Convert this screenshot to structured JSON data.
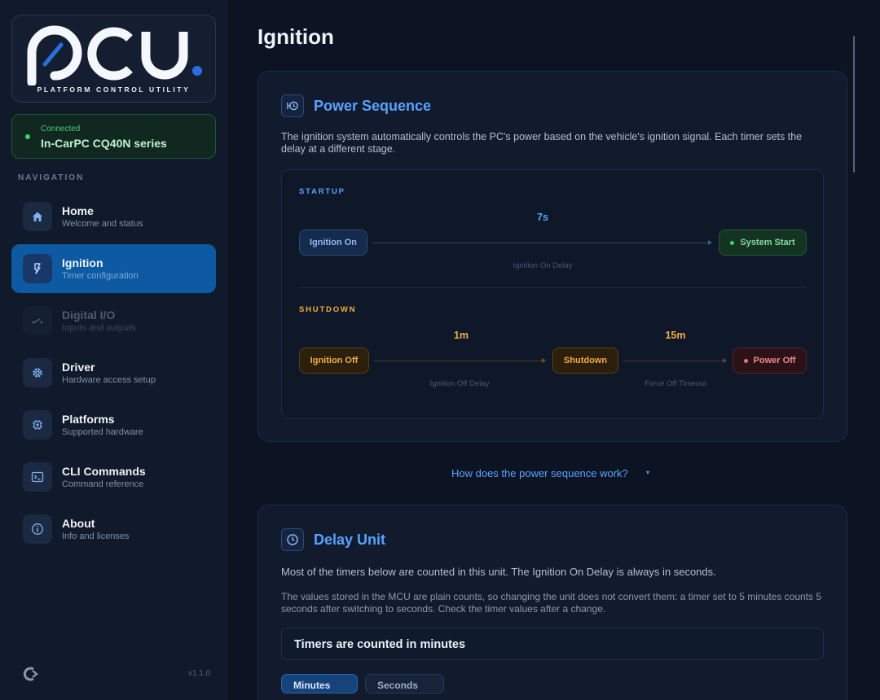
{
  "app": {
    "logo_text": "PCU",
    "logo_subtitle": "PLATFORM CONTROL UTILITY",
    "version": "v1.1.0"
  },
  "connection": {
    "status": "Connected",
    "device": "In-CarPC CQ40N series",
    "status_color": "#3bd273"
  },
  "navigation": {
    "title": "NAVIGATION",
    "items": [
      {
        "label": "Home",
        "sub": "Welcome and status",
        "icon": "home-icon"
      },
      {
        "label": "Ignition",
        "sub": "Timer configuration",
        "icon": "ignition-icon",
        "active": true
      },
      {
        "label": "Digital I/O",
        "sub": "Inputs and outputs",
        "icon": "switch-icon",
        "disabled": true
      },
      {
        "label": "Driver",
        "sub": "Hardware access setup",
        "icon": "gear-icon"
      },
      {
        "label": "Platforms",
        "sub": "Supported hardware",
        "icon": "chip-icon"
      },
      {
        "label": "CLI Commands",
        "sub": "Command reference",
        "icon": "terminal-icon"
      },
      {
        "label": "About",
        "sub": "Info and licenses",
        "icon": "info-icon"
      }
    ]
  },
  "page": {
    "title": "Ignition"
  },
  "power_sequence": {
    "title": "Power Sequence",
    "description": "The ignition system automatically controls the PC's power based on the vehicle's ignition signal. Each timer sets the delay at a different stage.",
    "startup": {
      "label": "STARTUP",
      "from": "Ignition On",
      "to": "System Start",
      "timer_value": "7s",
      "timer_caption": "Ignition On Delay"
    },
    "shutdown": {
      "label": "SHUTDOWN",
      "from": "Ignition Off",
      "middle": "Shutdown",
      "to": "Power Off",
      "timer1_value": "1m",
      "timer1_caption": "Ignition Off Delay",
      "timer2_value": "15m",
      "timer2_caption": "Force Off Timeout"
    },
    "help_link": "How does the power sequence work?"
  },
  "delay_unit": {
    "title": "Delay Unit",
    "description1": "Most of the timers below are counted in this unit. The Ignition On Delay is always in seconds.",
    "description2": "The values stored in the MCU are plain counts, so changing the unit does not convert them: a timer set to 5 minutes counts 5 seconds after switching to seconds. Check the timer values after a change.",
    "current": "Timers are counted in minutes",
    "options": [
      "Minutes",
      "Seconds"
    ]
  },
  "colors": {
    "accent": "#5aa2ff",
    "active_nav": "#0d5aa2",
    "startup_label": "#5aa2ff",
    "shutdown_label": "#f2ad45"
  }
}
